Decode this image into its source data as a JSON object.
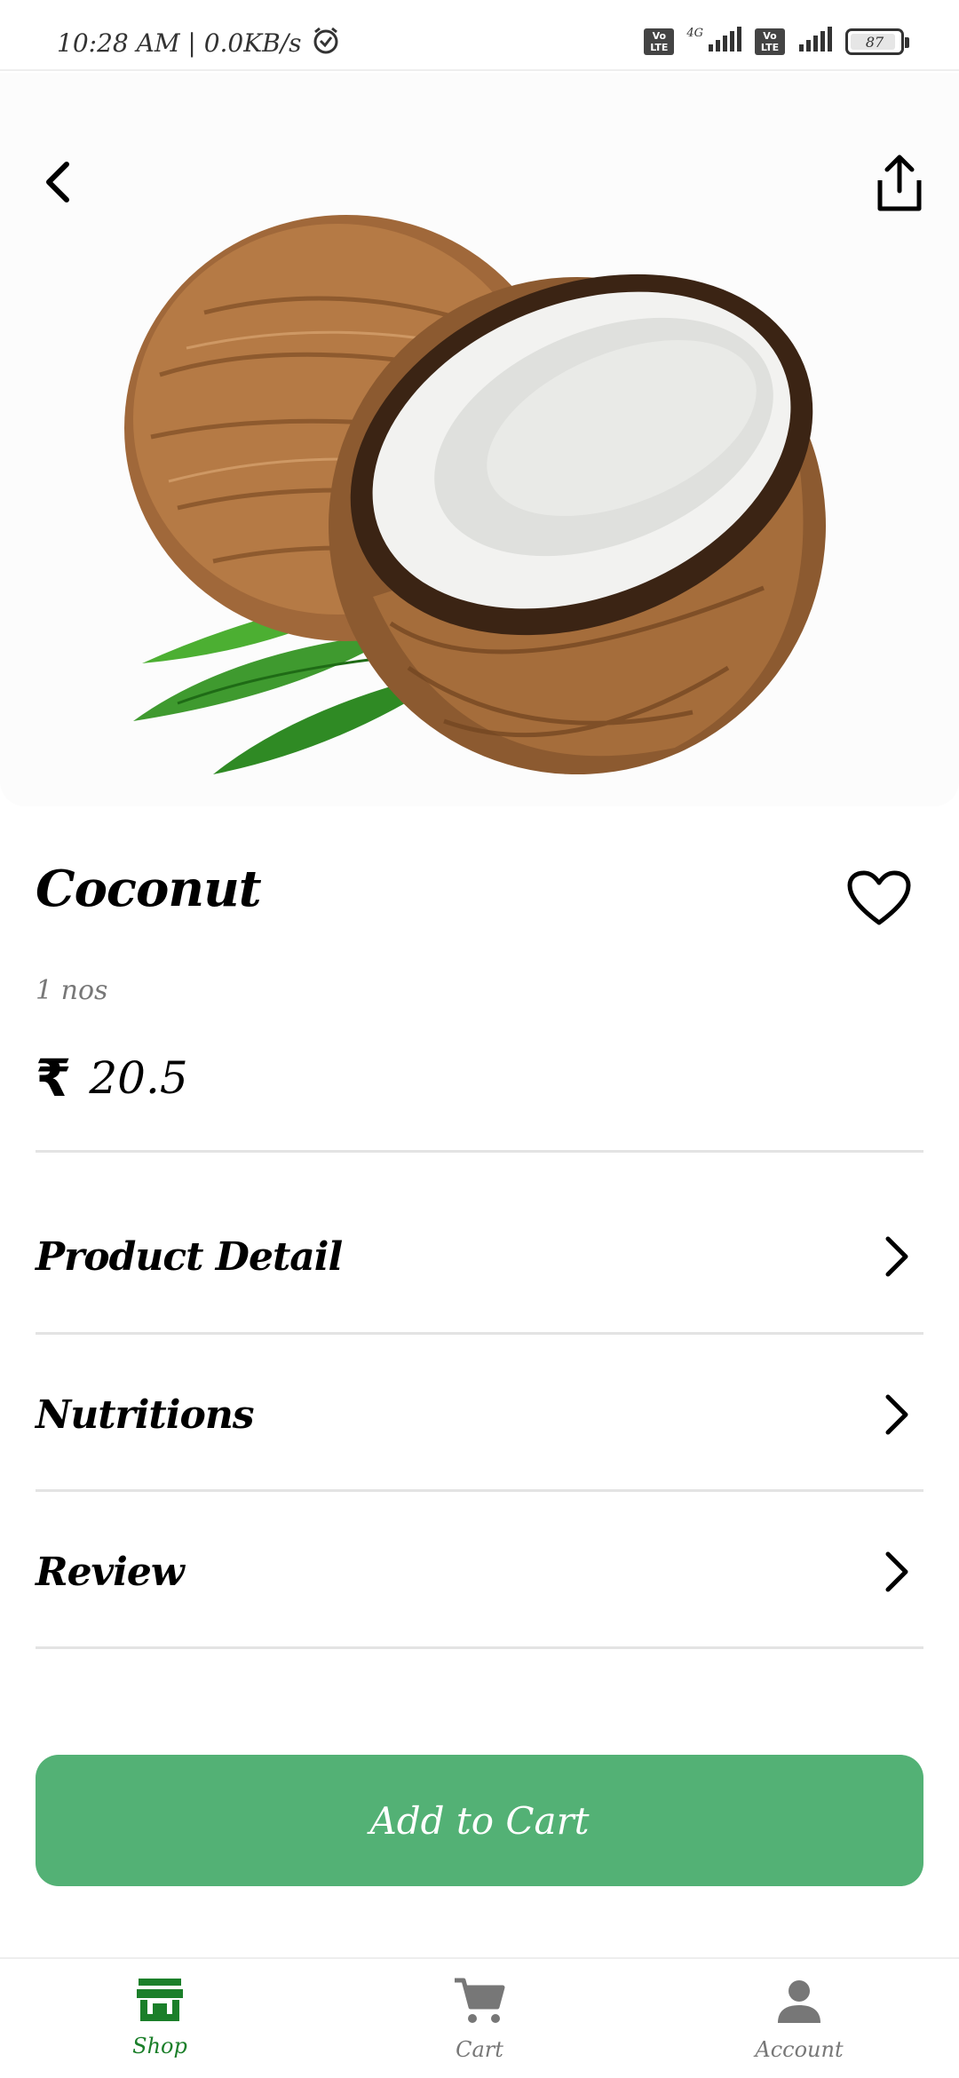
{
  "status_bar": {
    "time_speed": "10:28 AM | 0.0KB/s",
    "volte_1": "Vo LTE",
    "network": "4G",
    "volte_2": "Vo LTE",
    "battery": "87"
  },
  "product": {
    "name": "Coconut",
    "unit": "1 nos",
    "currency_symbol": "₹",
    "price": "20.5"
  },
  "sections": [
    {
      "label": "Product Detail"
    },
    {
      "label": "Nutritions"
    },
    {
      "label": "Review"
    }
  ],
  "add_to_cart_label": "Add to Cart",
  "bottom_nav": {
    "shop": "Shop",
    "cart": "Cart",
    "account": "Account"
  },
  "colors": {
    "accent": "#53b175",
    "active_nav": "#1b7f2a",
    "inactive_nav": "#777777"
  }
}
